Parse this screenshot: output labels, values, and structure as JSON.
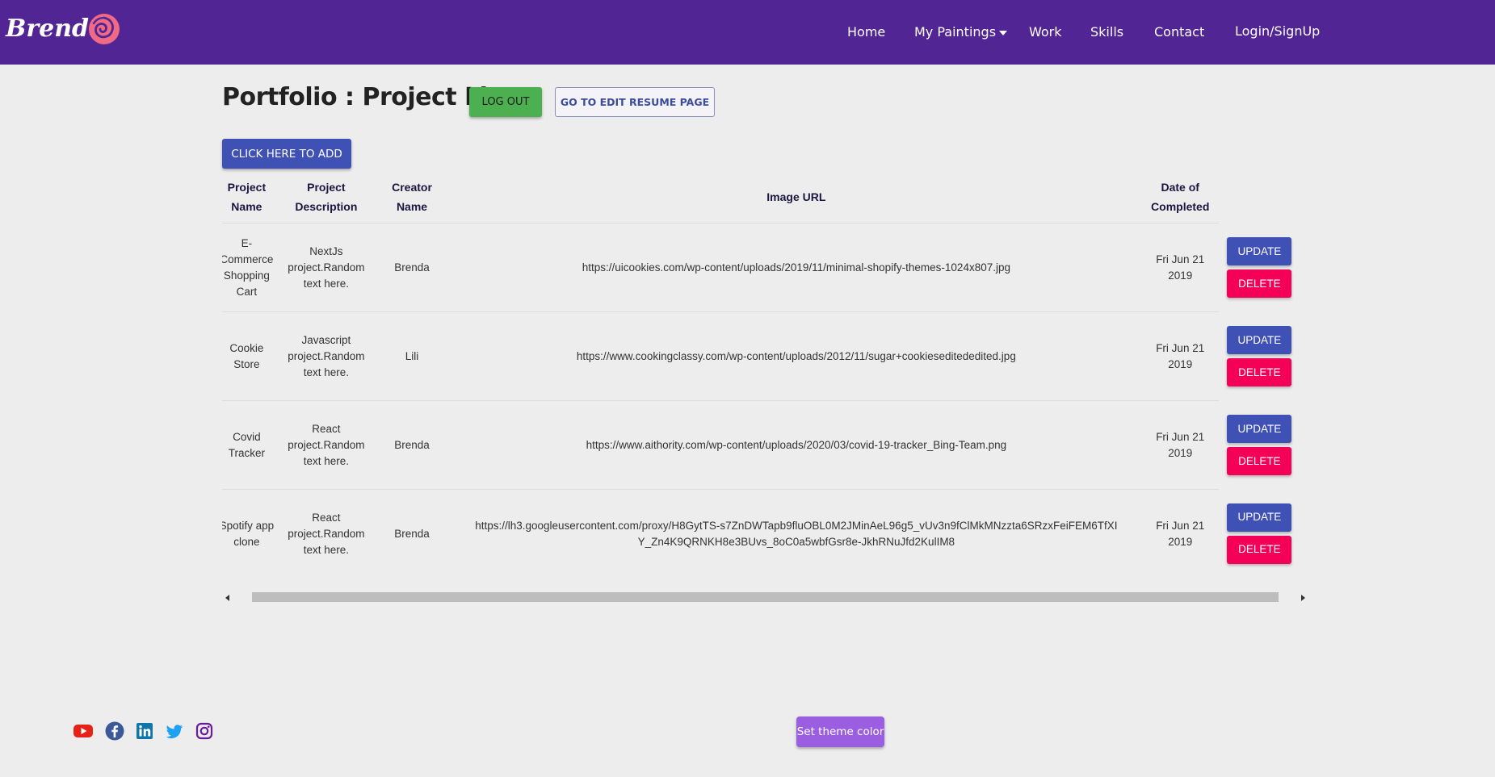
{
  "brand": {
    "name": "Brenda"
  },
  "nav": {
    "home": "Home",
    "paintings": "My Paintings",
    "work": "Work",
    "skills": "Skills",
    "contact": "Contact",
    "login": "Login/SignUp"
  },
  "page": {
    "title": "Portfolio : Project List",
    "logout_label": "LOG OUT",
    "edit_resume_label": "GO TO EDIT RESUME PAGE",
    "add_label": "CLICK HERE TO ADD"
  },
  "table": {
    "headers": {
      "name_l1": "Project",
      "name_l2": "Name",
      "desc_l1": "Project",
      "desc_l2": "Description",
      "creator_l1": "Creator",
      "creator_l2": "Name",
      "image": "Image URL",
      "date_l1": "Date of",
      "date_l2": "Completed"
    },
    "update_label": "UPDATE",
    "delete_label": "DELETE",
    "rows": [
      {
        "name": "E-Commerce Shopping Cart",
        "description": "NextJs project.Random text here.",
        "creator": "Brenda",
        "image_url": "https://uicookies.com/wp-content/uploads/2019/11/minimal-shopify-themes-1024x807.jpg",
        "date": "Fri Jun 21 2019"
      },
      {
        "name": "Cookie Store",
        "description": "Javascript project.Random text here.",
        "creator": "Lili",
        "image_url": "https://www.cookingclassy.com/wp-content/uploads/2012/11/sugar+cookieseditededited.jpg",
        "date": "Fri Jun 21 2019"
      },
      {
        "name": "Covid Tracker",
        "description": "React project.Random text here.",
        "creator": "Brenda",
        "image_url": "https://www.aithority.com/wp-content/uploads/2020/03/covid-19-tracker_Bing-Team.png",
        "date": "Fri Jun 21 2019"
      },
      {
        "name": "Spotify app clone",
        "description": "React project.Random text here.",
        "creator": "Brenda",
        "image_url": "https://lh3.googleusercontent.com/proxy/H8GytTS-s7ZnDWTapb9fluOBL0M2JMinAeL96g5_vUv3n9fClMkMNzzta6SRzxFeiFEM6TfXIY_Zn4K9QRNKH8e3BUvs_8oC0a5wbfGsr8e-JkhRNuJfd2KulIM8",
        "date": "Fri Jun 21 2019"
      }
    ]
  },
  "footer": {
    "theme_label": "Set theme color",
    "social_icons": [
      "youtube-icon",
      "facebook-icon",
      "linkedin-icon",
      "twitter-icon",
      "instagram-icon"
    ]
  },
  "colors": {
    "navbar": "#512593",
    "logout": "#4caf50",
    "primary": "#3f51b5",
    "delete": "#f50057",
    "theme_button": "#9c5ee0",
    "background": "#ededed"
  }
}
